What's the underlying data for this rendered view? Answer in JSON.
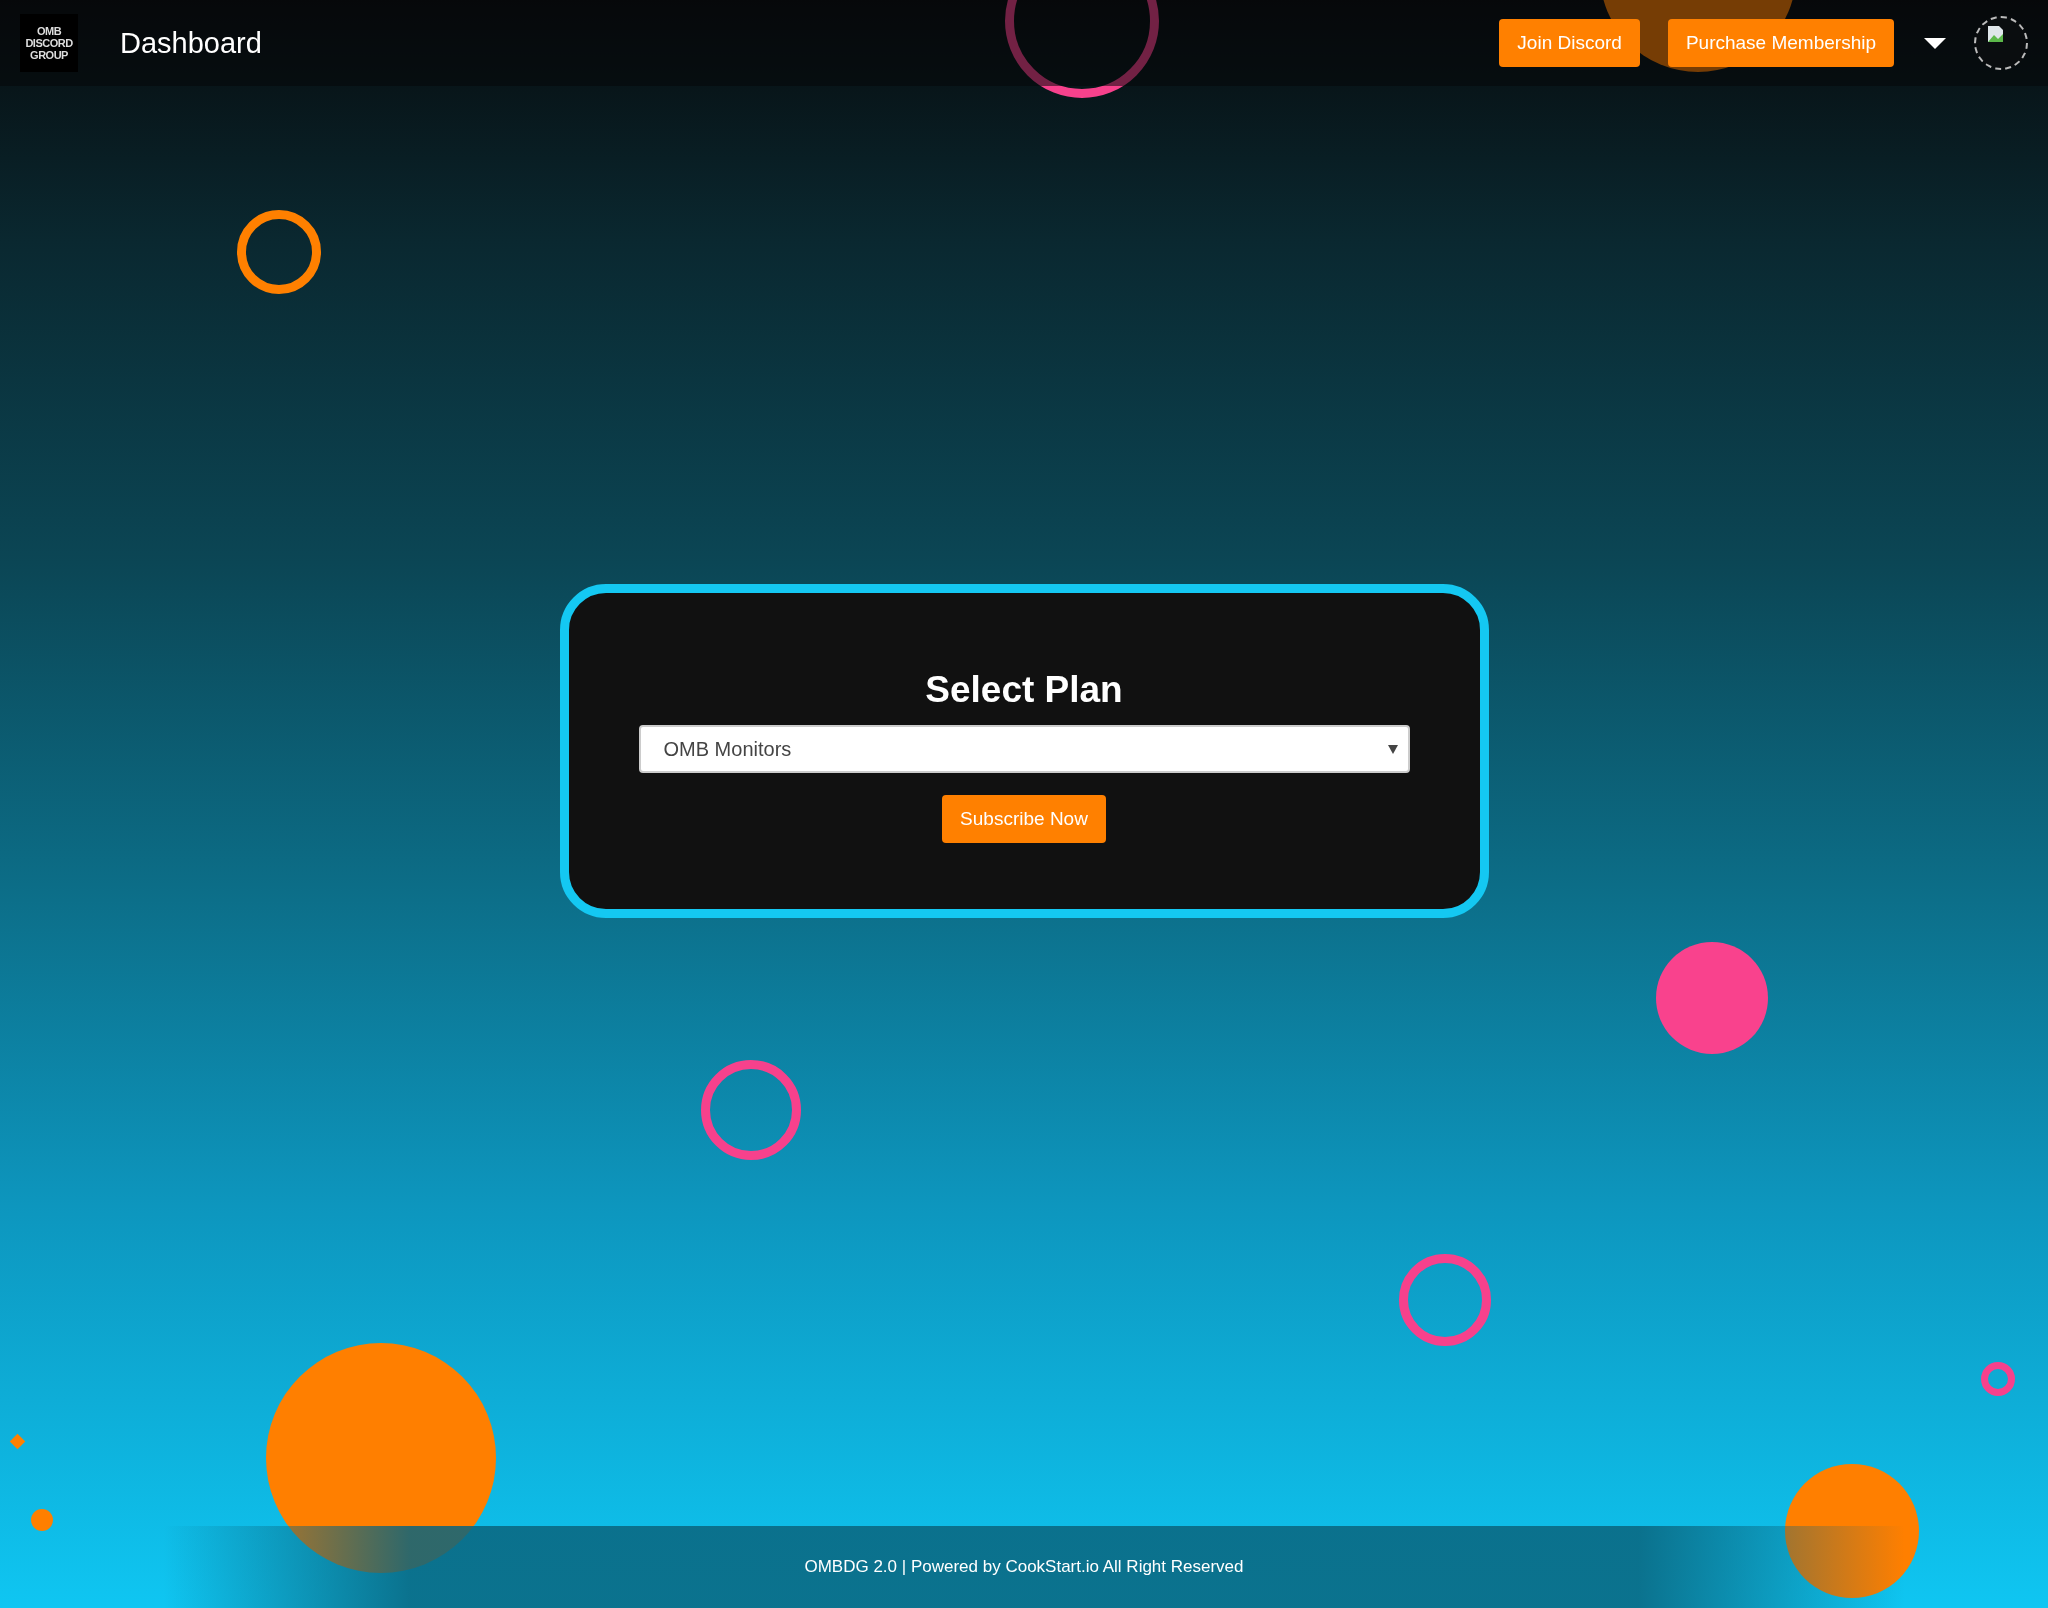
{
  "header": {
    "logo_lines": [
      "OMB",
      "DISCORD",
      "GROUP"
    ],
    "title": "Dashboard",
    "buttons": [
      "Join Discord",
      "Purchase Membership"
    ]
  },
  "plan_card": {
    "title": "Select Plan",
    "plan_select": {
      "value": "OMB Monitors"
    },
    "button": "Subscribe Now"
  },
  "footer": {
    "text": "OMBDG 2.0 | Powered by CookStart.io All Right Reserved"
  }
}
